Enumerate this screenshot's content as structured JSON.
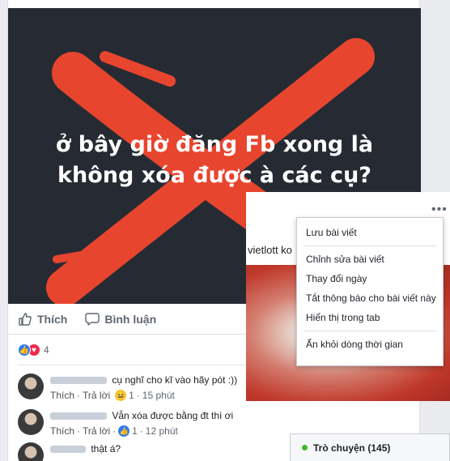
{
  "post": {
    "image_caption_line1": "ở bây giờ đăng Fb xong là",
    "image_caption_line2": "không xóa được à các cụ?",
    "like_label": "Thích",
    "comment_label": "Bình luận",
    "reaction_count": "4"
  },
  "comments": [
    {
      "text": "cụ nghĩ cho kĩ vào hãy pót :))",
      "like_label": "Thích",
      "reply_label": "Trả lời",
      "reaction_count": "1",
      "time": "15 phút"
    },
    {
      "text": "Vẫn xóa được bằng đt thì ơi",
      "like_label": "Thích",
      "reply_label": "Trả lời",
      "reaction_count": "1",
      "time": "12 phút"
    },
    {
      "text": "thật á?"
    }
  ],
  "overlay": {
    "text": "vietlott ko"
  },
  "menu": {
    "items": [
      "Lưu bài viết",
      "Chỉnh sửa bài viết",
      "Thay đổi ngày",
      "Tắt thông báo cho bài viết này",
      "Hiển thị trong tab",
      "Ẩn khỏi dòng thời gian"
    ]
  },
  "chat": {
    "label": "Trò chuyện (145)"
  },
  "colors": {
    "image_bg": "#262b33",
    "x_mark": "#e8452f",
    "like_blue": "#2e7bf6",
    "love_red": "#f0284a",
    "online_green": "#42b72a"
  }
}
